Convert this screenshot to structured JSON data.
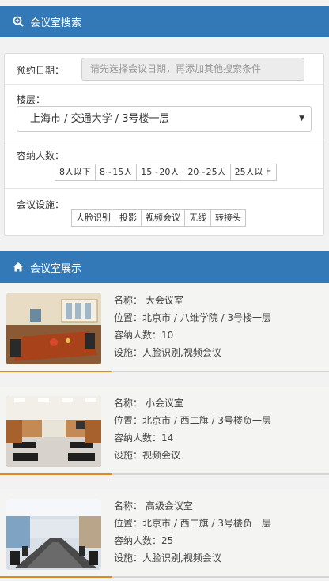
{
  "search_section": {
    "title": "会议室搜索",
    "icon": "search-plus-icon"
  },
  "search_form": {
    "date": {
      "label": "预约日期：",
      "placeholder": "请先选择会议日期，再添加其他搜索条件"
    },
    "floor": {
      "label": "楼层：",
      "selected": "上海市 / 交通大学 / 3号楼一层"
    },
    "capacity": {
      "label": "容纳人数：",
      "options": [
        "8人以下",
        "8~15人",
        "15~20人",
        "20~25人",
        "25人以上"
      ]
    },
    "facility": {
      "label": "会议设施：",
      "options": [
        "人脸识别",
        "投影",
        "视频会议",
        "无线",
        "转接头"
      ]
    }
  },
  "rooms_section": {
    "title": "会议室展示",
    "icon": "home-icon"
  },
  "field_labels": {
    "name": "名称：",
    "location": "位置：",
    "capacity": "容纳人数：",
    "facilities": "设施："
  },
  "rooms": [
    {
      "name": "大会议室",
      "location": "北京市 / 八维学院 / 3号楼一层",
      "capacity": "10",
      "facilities": "人脸识别,视频会议"
    },
    {
      "name": "小会议室",
      "location": "北京市 / 西二旗 / 3号楼负一层",
      "capacity": "14",
      "facilities": "视频会议"
    },
    {
      "name": "高级会议室",
      "location": "北京市 / 西二旗 / 3号楼负一层",
      "capacity": "25",
      "facilities": "人脸识别,视频会议"
    }
  ],
  "colors": {
    "header_blue": "#3379b7",
    "accent_orange": "#e08a1e"
  }
}
